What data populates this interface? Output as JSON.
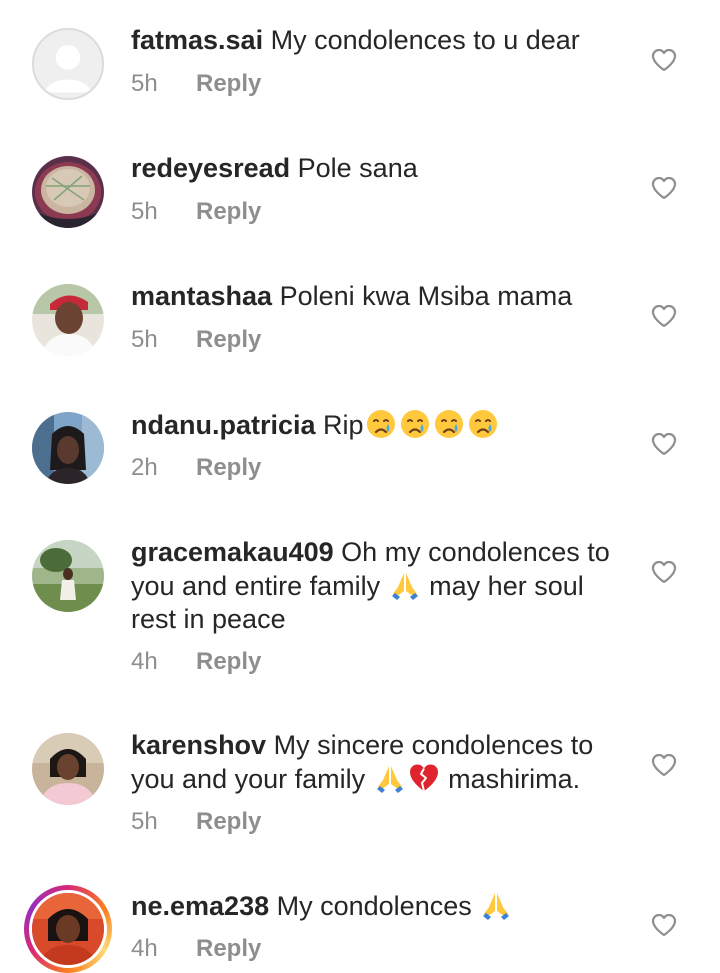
{
  "reply_label": "Reply",
  "comments": [
    {
      "username": "fatmas.sai",
      "text": "My condolences to u dear",
      "time": "5h"
    },
    {
      "username": "redeyesread",
      "text": "Pole sana",
      "time": "5h"
    },
    {
      "username": "mantashaa",
      "text": "Poleni kwa Msiba mama",
      "time": "5h"
    },
    {
      "username": "ndanu.patricia",
      "text": "Rip",
      "time": "2h",
      "emojis": [
        "crying-face",
        "crying-face",
        "crying-face",
        "crying-face"
      ]
    },
    {
      "username": "gracemakau409",
      "text_before": "Oh my condolences to you and entire family",
      "text_after": "may her soul rest in peace",
      "time": "4h",
      "emojis": [
        "folded-hands"
      ]
    },
    {
      "username": "karenshov",
      "text_before": "My sincere condolences to you and your family",
      "text_after": "mashirima.",
      "time": "5h",
      "emojis": [
        "folded-hands",
        "broken-heart"
      ]
    },
    {
      "username": "ne.ema238",
      "text": "My condolences",
      "time": "4h",
      "emojis": [
        "folded-hands"
      ]
    }
  ]
}
